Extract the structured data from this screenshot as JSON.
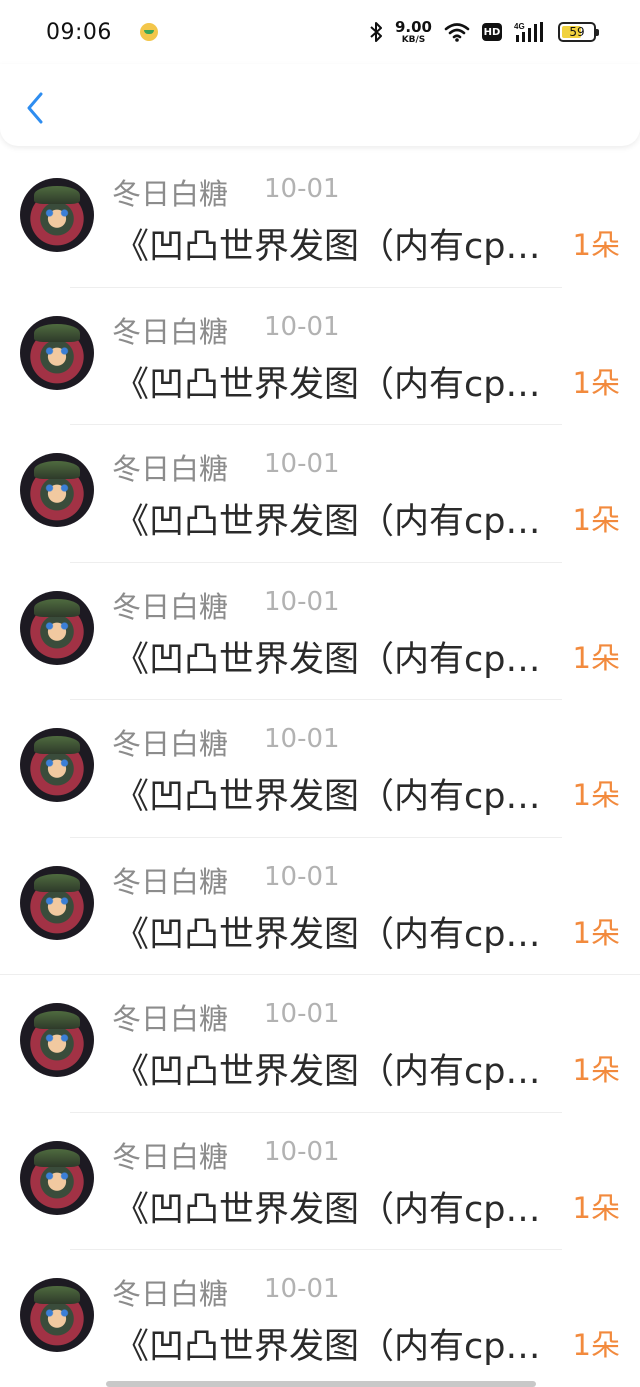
{
  "status_bar": {
    "time": "09:06",
    "net_speed_value": "9.00",
    "net_speed_unit": "KB/S",
    "hd_label": "HD",
    "network_type": "4G",
    "battery_level": "59"
  },
  "colors": {
    "accent_blue": "#2e8df0",
    "count_orange": "#f28a3d",
    "name_gray": "#8c8c8c",
    "date_gray": "#b2b2b2"
  },
  "items": [
    {
      "name": "冬日白糖",
      "date": "10-01",
      "title": "《凹凸世界发图（内有cp）》",
      "count": "1朵"
    },
    {
      "name": "冬日白糖",
      "date": "10-01",
      "title": "《凹凸世界发图（内有cp）》",
      "count": "1朵"
    },
    {
      "name": "冬日白糖",
      "date": "10-01",
      "title": "《凹凸世界发图（内有cp）》",
      "count": "1朵"
    },
    {
      "name": "冬日白糖",
      "date": "10-01",
      "title": "《凹凸世界发图（内有cp）》",
      "count": "1朵"
    },
    {
      "name": "冬日白糖",
      "date": "10-01",
      "title": "《凹凸世界发图（内有cp）》",
      "count": "1朵"
    },
    {
      "name": "冬日白糖",
      "date": "10-01",
      "title": "《凹凸世界发图（内有cp）》",
      "count": "1朵"
    },
    {
      "name": "冬日白糖",
      "date": "10-01",
      "title": "《凹凸世界发图（内有cp）》",
      "count": "1朵"
    },
    {
      "name": "冬日白糖",
      "date": "10-01",
      "title": "《凹凸世界发图（内有cp）》",
      "count": "1朵"
    },
    {
      "name": "冬日白糖",
      "date": "10-01",
      "title": "《凹凸世界发图（内有cp）》",
      "count": "1朵"
    }
  ]
}
